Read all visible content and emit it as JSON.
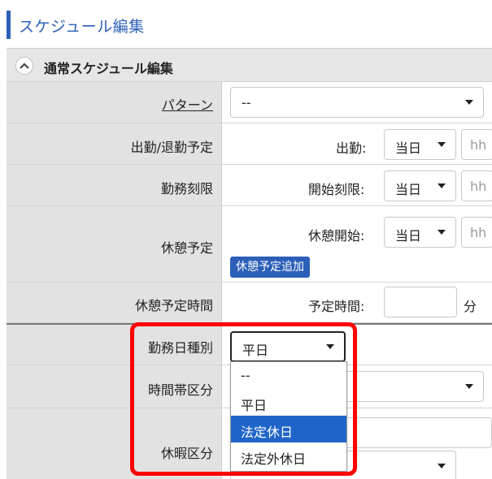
{
  "page": {
    "title": "スケジュール編集"
  },
  "section": {
    "title": "通常スケジュール編集"
  },
  "rows": {
    "pattern": {
      "label": "パターン",
      "value": "--"
    },
    "attendance": {
      "label": "出勤/退勤予定",
      "field_label": "出勤:",
      "day_value": "当日",
      "time_placeholder": "hh"
    },
    "work_limit": {
      "label": "勤務刻限",
      "field_label": "開始刻限:",
      "day_value": "当日",
      "time_placeholder": "hh"
    },
    "break": {
      "label": "休憩予定",
      "field_label": "休憩開始:",
      "day_value": "当日",
      "time_placeholder": "hh",
      "add_button": "休憩予定追加"
    },
    "break_time": {
      "label": "休憩予定時間",
      "field_label": "予定時間:",
      "unit": "分"
    },
    "day_type": {
      "label": "勤務日種別",
      "value": "平日"
    },
    "time_zone": {
      "label": "時間帯区分"
    },
    "leave": {
      "label": "休暇区分"
    }
  },
  "dropdown": {
    "options": [
      "--",
      "平日",
      "法定休日",
      "法定外休日"
    ],
    "highlighted": "法定休日"
  },
  "colors": {
    "accent": "#2b5fb8",
    "highlight_border": "#ff0000",
    "selected_option": "#1f64c8"
  }
}
